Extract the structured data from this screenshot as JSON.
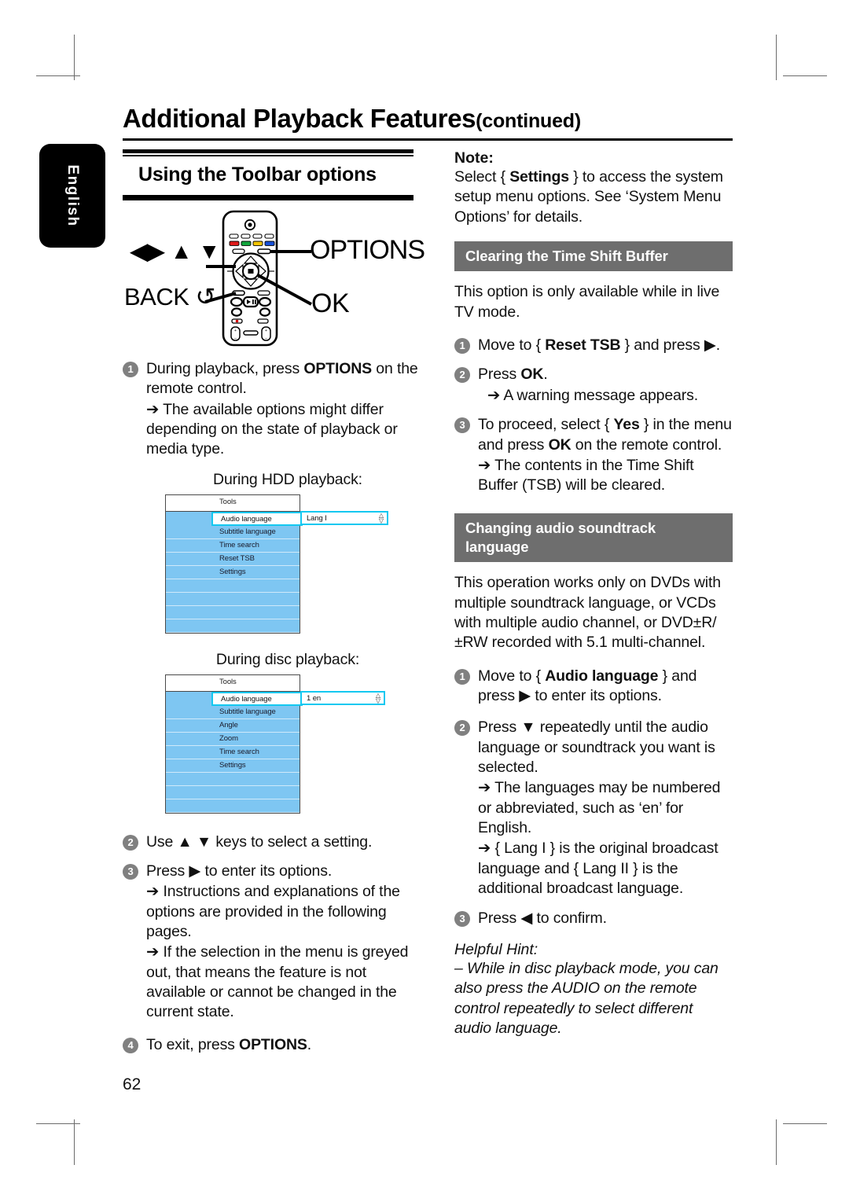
{
  "page": {
    "number": "62",
    "language_tab": "English",
    "title": "Additional Playback Features",
    "title_continued": "(continued)"
  },
  "left_column": {
    "section_heading": "Using the Toolbar options",
    "remote_labels": {
      "nav_keys": "◀▶ ▲ ▼",
      "back": "BACK ↺",
      "options": "OPTIONS",
      "ok": "OK"
    },
    "steps": [
      {
        "num": "1",
        "text_before": "During playback, press ",
        "bold": "OPTIONS",
        "text_after": " on the remote control.",
        "sub": [
          "➔ The available options might differ depending on the state of playback or media type."
        ]
      },
      {
        "num": "2",
        "text_before": "Use ▲ ▼ keys to select a setting.",
        "bold": "",
        "text_after": "",
        "sub": []
      },
      {
        "num": "3",
        "text_before": "Press ▶ to enter its options.",
        "bold": "",
        "text_after": "",
        "sub": [
          "➔ Instructions and explanations of the options are provided in the following pages.",
          "➔ If the selection in the menu is greyed out, that means the feature is not available or cannot be changed in the current state."
        ]
      },
      {
        "num": "4",
        "text_before": "To exit, press ",
        "bold": "OPTIONS",
        "text_after": ".",
        "sub": []
      }
    ],
    "hdd_menu": {
      "caption": "During HDD playback:",
      "title": "Tools",
      "selected_item": "Audio language",
      "selected_value": "Lang I",
      "items": [
        "Subtitle language",
        "Time search",
        "Reset TSB",
        "Settings"
      ]
    },
    "disc_menu": {
      "caption": "During disc playback:",
      "title": "Tools",
      "selected_item": "Audio language",
      "selected_value": "1 en",
      "items": [
        "Subtitle language",
        "Angle",
        "Zoom",
        "Time search",
        "Settings"
      ]
    }
  },
  "right_column": {
    "note_label": "Note:",
    "note_before": "Select { ",
    "note_bold": "Settings",
    "note_after": " } to access the system setup menu options.  See ‘System Menu Options’ for details.",
    "section_tsb": {
      "heading": "Clearing the Time Shift Buffer",
      "intro": "This option is only available while in live TV mode.",
      "steps": [
        {
          "num": "1",
          "before": "Move to { ",
          "bold": "Reset TSB",
          "after": " } and press ▶.",
          "sub": []
        },
        {
          "num": "2",
          "before": "Press ",
          "bold": "OK",
          "after": ".",
          "sub": [
            "➔ A warning message appears."
          ]
        },
        {
          "num": "3",
          "before": "To proceed, select { ",
          "bold": "Yes",
          "after": " } in the menu and press ",
          "bold2": "OK",
          "after2": " on the remote control.",
          "sub": [
            "➔ The contents in the Time Shift Buffer (TSB) will be cleared."
          ]
        }
      ]
    },
    "section_audio": {
      "heading_line1": "Changing audio soundtrack",
      "heading_line2": "language",
      "intro": "This operation works only on DVDs with multiple soundtrack language, or VCDs with multiple audio channel, or DVD±R/±RW recorded with 5.1 multi-channel.",
      "steps": [
        {
          "num": "1",
          "before": "Move to { ",
          "bold": "Audio language",
          "after": " } and press ▶ to enter its options.",
          "sub": []
        },
        {
          "num": "2",
          "before": "Press ▼ repeatedly until the audio language or soundtrack you want is selected.",
          "bold": "",
          "after": "",
          "sub": [
            "➔ The languages may be numbered or abbreviated, such as ‘en’ for English.",
            "➔ { Lang I } is the original broadcast language and { Lang II } is the additional broadcast language."
          ]
        },
        {
          "num": "3",
          "before": "Press ◀ to confirm.",
          "bold": "",
          "after": "",
          "sub": []
        }
      ],
      "hint_title": "Helpful Hint:",
      "hint_body": "– While in disc playback mode, you can also press the AUDIO on the remote control repeatedly to select different audio language."
    }
  },
  "colors": {
    "menu_blue": "#7ec6f2",
    "highlight_cyan": "#14c8f0",
    "section_grey": "#6e6e6e",
    "step_bullet_grey": "#808080"
  }
}
